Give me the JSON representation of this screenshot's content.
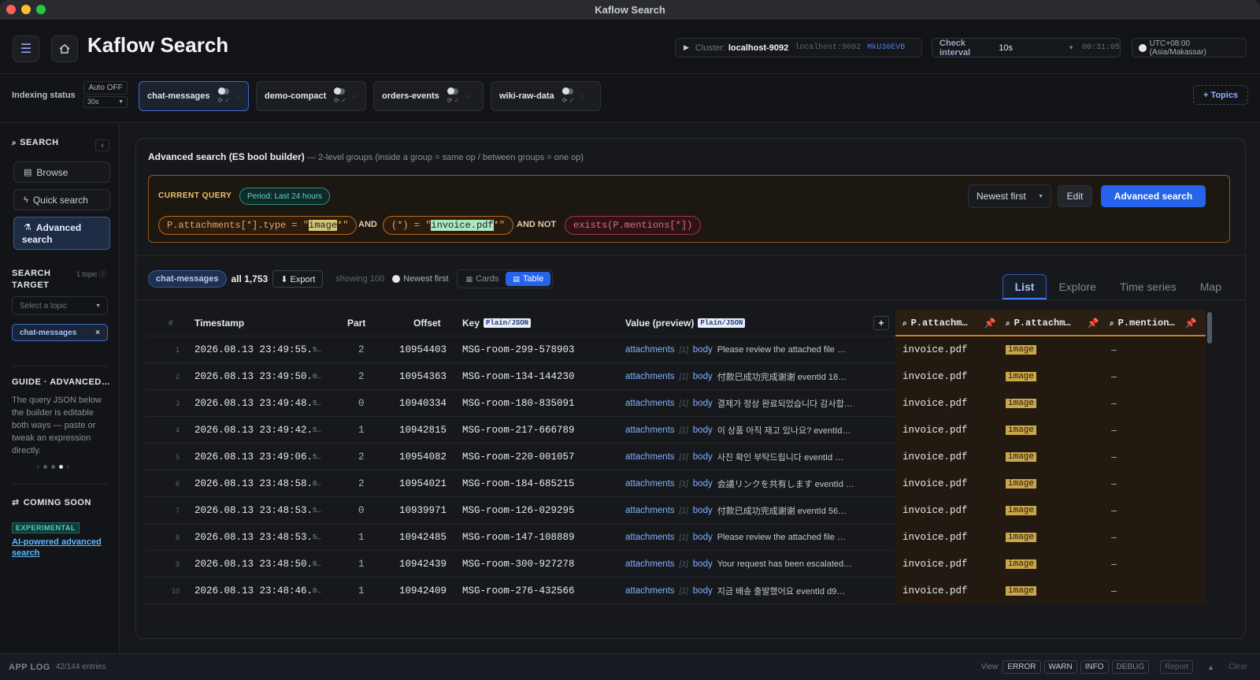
{
  "window": {
    "title": "Kaflow Search"
  },
  "header": {
    "app_title": "Kaflow Search",
    "cluster_label": "Cluster:",
    "cluster_name": "localhost-9092",
    "cluster_address": "localhost:9092",
    "cluster_id": "MkU30EVB",
    "interval_label": "Check interval",
    "interval_value": "10s",
    "interval_timer": "00:31:05",
    "timezone": "UTC+08:00 (Asia/Makassar)"
  },
  "indexing": {
    "label": "Indexing status",
    "auto_label": "Auto OFF",
    "auto_interval": "30s",
    "topics": [
      "chat-messages",
      "demo-compact",
      "orders-events",
      "wiki-raw-data"
    ],
    "add_topics": "+ Topics"
  },
  "sidebar": {
    "search_heading": "SEARCH",
    "collapse": "‹",
    "browse": "Browse",
    "quick_search": "Quick search",
    "advanced_search_1": "Advanced",
    "advanced_search_2": "search",
    "target_heading_1": "SEARCH",
    "target_heading_2": "TARGET",
    "topic_count": "1 topic ⓘ",
    "select_placeholder": "Select a topic",
    "selected_topic": "chat-messages",
    "remove": "×",
    "guide_heading": "GUIDE · ADVANCED…",
    "guide_text": "The query JSON below the builder is editable both ways — paste or tweak an expression directly.",
    "pager_prev": "‹",
    "pager_next": "›",
    "coming_soon": "COMING SOON",
    "experimental": "EXPERIMENTAL",
    "ai_link_1": "AI-powered advanced",
    "ai_link_2": "search"
  },
  "main": {
    "title": "Advanced search (ES bool builder)",
    "subtitle": "— 2-level groups (inside a group = same op / between groups = one op)",
    "current_query_label": "CURRENT QUERY",
    "period": "Period: Last 24 hours",
    "chip1_pre": "P.attachments[*].type = \"",
    "chip1_hl": "image",
    "chip1_post": "*\"",
    "op_and": "AND",
    "chip2_pre": "(*) = \"",
    "chip2_hl": "invoice.pdf",
    "chip2_post": "*\"",
    "op_and_not": "AND NOT",
    "chip3": "exists(P.mentions[*])",
    "sort": "Newest first",
    "edit": "Edit",
    "advanced_search": "Advanced search"
  },
  "results": {
    "topic": "chat-messages",
    "count": "all 1,753",
    "export": "⬇ Export",
    "showing": "showing 100",
    "sort": "Newest first",
    "view_cards": "Cards",
    "view_table": "Table",
    "tabs": [
      "List",
      "Explore",
      "Time series",
      "Map"
    ]
  },
  "table": {
    "headers": {
      "num": "#",
      "timestamp": "Timestamp",
      "part": "Part",
      "offset": "Offset",
      "key": "Key",
      "key_tag": "Plain/JSON",
      "value": "Value (preview)",
      "value_tag": "Plain/JSON",
      "add": "+",
      "col1": "P.attachm…",
      "col2": "P.attachm…",
      "col3": "P.mention…"
    },
    "rows": [
      {
        "n": "1",
        "ts": "2026.08.13 23:49:55.",
        "ms": "5…",
        "part": "2",
        "offset": "10954403",
        "key": "MSG-room-299-578903",
        "v1": "attachments",
        "v2": "[1]",
        "v3": "body",
        "v4": "Please review the attached file  …",
        "c1": "invoice.pdf",
        "c2": "image",
        "c3": "–"
      },
      {
        "n": "2",
        "ts": "2026.08.13 23:49:50.",
        "ms": "0…",
        "part": "2",
        "offset": "10954363",
        "key": "MSG-room-134-144230",
        "v1": "attachments",
        "v2": "[1]",
        "v3": "body",
        "v4": "付款已成功完成谢谢  eventId  18…",
        "c1": "invoice.pdf",
        "c2": "image",
        "c3": "–"
      },
      {
        "n": "3",
        "ts": "2026.08.13 23:49:48.",
        "ms": "5…",
        "part": "0",
        "offset": "10940334",
        "key": "MSG-room-180-835091",
        "v1": "attachments",
        "v2": "[1]",
        "v3": "body",
        "v4": "결제가 정상 완료되었습니다 감사합…",
        "c1": "invoice.pdf",
        "c2": "image",
        "c3": "–"
      },
      {
        "n": "4",
        "ts": "2026.08.13 23:49:42.",
        "ms": "5…",
        "part": "1",
        "offset": "10942815",
        "key": "MSG-room-217-666789",
        "v1": "attachments",
        "v2": "[1]",
        "v3": "body",
        "v4": "이 상품 아직 재고 있나요?  eventId…",
        "c1": "invoice.pdf",
        "c2": "image",
        "c3": "–"
      },
      {
        "n": "5",
        "ts": "2026.08.13 23:49:06.",
        "ms": "5…",
        "part": "2",
        "offset": "10954082",
        "key": "MSG-room-220-001057",
        "v1": "attachments",
        "v2": "[1]",
        "v3": "body",
        "v4": "사진 확인 부탁드립니다  eventId  …",
        "c1": "invoice.pdf",
        "c2": "image",
        "c3": "–"
      },
      {
        "n": "6",
        "ts": "2026.08.13 23:48:58.",
        "ms": "0…",
        "part": "2",
        "offset": "10954021",
        "key": "MSG-room-184-685215",
        "v1": "attachments",
        "v2": "[1]",
        "v3": "body",
        "v4": "会議リンクを共有します  eventId  …",
        "c1": "invoice.pdf",
        "c2": "image",
        "c3": "–"
      },
      {
        "n": "7",
        "ts": "2026.08.13 23:48:53.",
        "ms": "5…",
        "part": "0",
        "offset": "10939971",
        "key": "MSG-room-126-029295",
        "v1": "attachments",
        "v2": "[1]",
        "v3": "body",
        "v4": "付款已成功完成谢谢  eventId  56…",
        "c1": "invoice.pdf",
        "c2": "image",
        "c3": "–"
      },
      {
        "n": "8",
        "ts": "2026.08.13 23:48:53.",
        "ms": "5…",
        "part": "1",
        "offset": "10942485",
        "key": "MSG-room-147-108889",
        "v1": "attachments",
        "v2": "[1]",
        "v3": "body",
        "v4": "Please review the attached file  …",
        "c1": "invoice.pdf",
        "c2": "image",
        "c3": "–"
      },
      {
        "n": "9",
        "ts": "2026.08.13 23:48:50.",
        "ms": "0…",
        "part": "1",
        "offset": "10942439",
        "key": "MSG-room-300-927278",
        "v1": "attachments",
        "v2": "[1]",
        "v3": "body",
        "v4": "Your request has been escalated…",
        "c1": "invoice.pdf",
        "c2": "image",
        "c3": "–"
      },
      {
        "n": "10",
        "ts": "2026.08.13 23:48:46.",
        "ms": "0…",
        "part": "1",
        "offset": "10942409",
        "key": "MSG-room-276-432566",
        "v1": "attachments",
        "v2": "[1]",
        "v3": "body",
        "v4": "지금 배송 출발했어요  eventId  d9…",
        "c1": "invoice.pdf",
        "c2": "image",
        "c3": "–"
      }
    ]
  },
  "applog": {
    "title": "APP LOG",
    "entries": "42/144 entries",
    "view_label": "View",
    "levels": [
      "ERROR",
      "WARN",
      "INFO",
      "DEBUG"
    ],
    "report": "Report",
    "clear": "Clear"
  }
}
